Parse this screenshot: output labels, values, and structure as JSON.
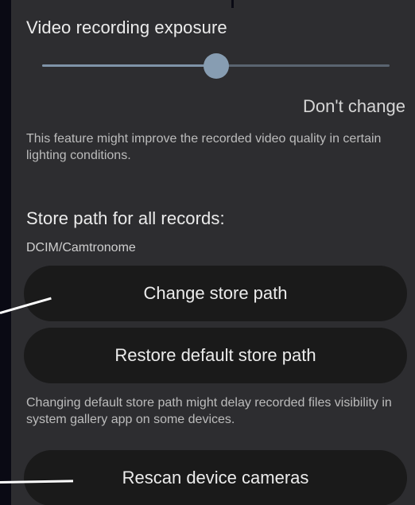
{
  "exposure": {
    "title": "Video recording exposure",
    "slider_fraction": 0.5,
    "value": "Don't change",
    "description": "This feature might improve the recorded video quality in certain lighting conditions."
  },
  "store": {
    "title": "Store path for all records:",
    "path": "DCIM/Camtronome",
    "change_button": "Change store path",
    "restore_button": "Restore default store path",
    "note": "Changing default store path might delay recorded files visibility in system gallery app on some devices."
  },
  "rescan_button": "Rescan device cameras",
  "colors": {
    "panel": "#2d2d30",
    "button": "#1a1a1a",
    "slider_thumb": "#879db2",
    "backdrop": "#0a0a14"
  }
}
